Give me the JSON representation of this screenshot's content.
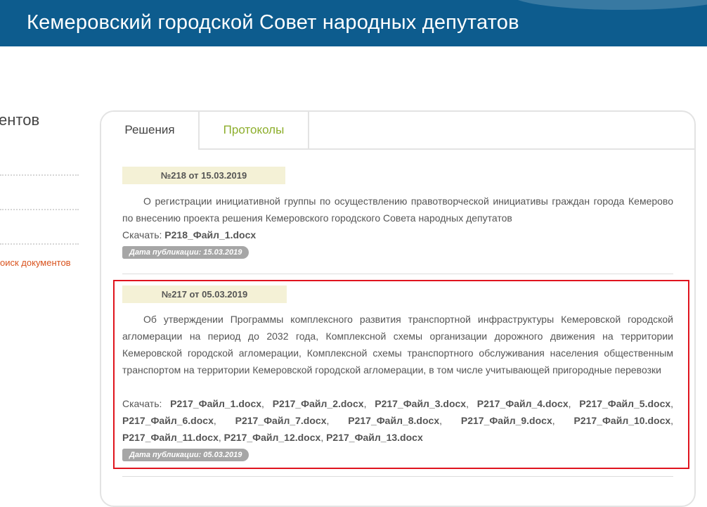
{
  "header": {
    "title": "Кемеровский городской Совет народных депутатов"
  },
  "sidebar": {
    "heading": "ентов",
    "link": "оиск документов"
  },
  "tabs": [
    {
      "label": "Решения",
      "active": true
    },
    {
      "label": "Протоколы",
      "active": false
    }
  ],
  "documents": [
    {
      "number": "№218 от 15.03.2019",
      "title": "О регистрации инициативной группы по осуществлению правотворческой инициативы граждан города Кемерово по внесению проекта решения Кемеровского городского Совета народных депутатов",
      "download_label": "Скачать:",
      "files": [
        "Р218_Файл_1.docx"
      ],
      "pub_date": "Дата публикации: 15.03.2019"
    },
    {
      "number": "№217 от 05.03.2019",
      "title": "Об утверждении Программы комплексного развития транспортной инфраструктуры Кемеровской городской агломерации на период до 2032 года, Комплексной схемы организации дорожного движения на территории Кемеровской городской агломерации, Комплексной схемы транспортного обслуживания населения общественным транспортом на территории Кемеровской городской агломерации, в том числе учитывающей пригородные перевозки",
      "download_label": "Скачать:",
      "files": [
        "Р217_Файл_1.docx",
        "Р217_Файл_2.docx",
        "Р217_Файл_3.docx",
        "Р217_Файл_4.docx",
        "Р217_Файл_5.docx",
        "Р217_Файл_6.docx",
        "Р217_Файл_7.docx",
        "Р217_Файл_8.docx",
        "Р217_Файл_9.docx",
        "Р217_Файл_10.docx",
        "Р217_Файл_11.docx",
        "Р217_Файл_12.docx",
        "Р217_Файл_13.docx"
      ],
      "pub_date": "Дата публикации: 05.03.2019"
    }
  ],
  "colors": {
    "header_bg": "#0d5c8e",
    "tab_inactive": "#8dae2c",
    "link_orange": "#d9531e",
    "highlight_border": "#e0141e",
    "number_bg": "#f4f1d6"
  }
}
